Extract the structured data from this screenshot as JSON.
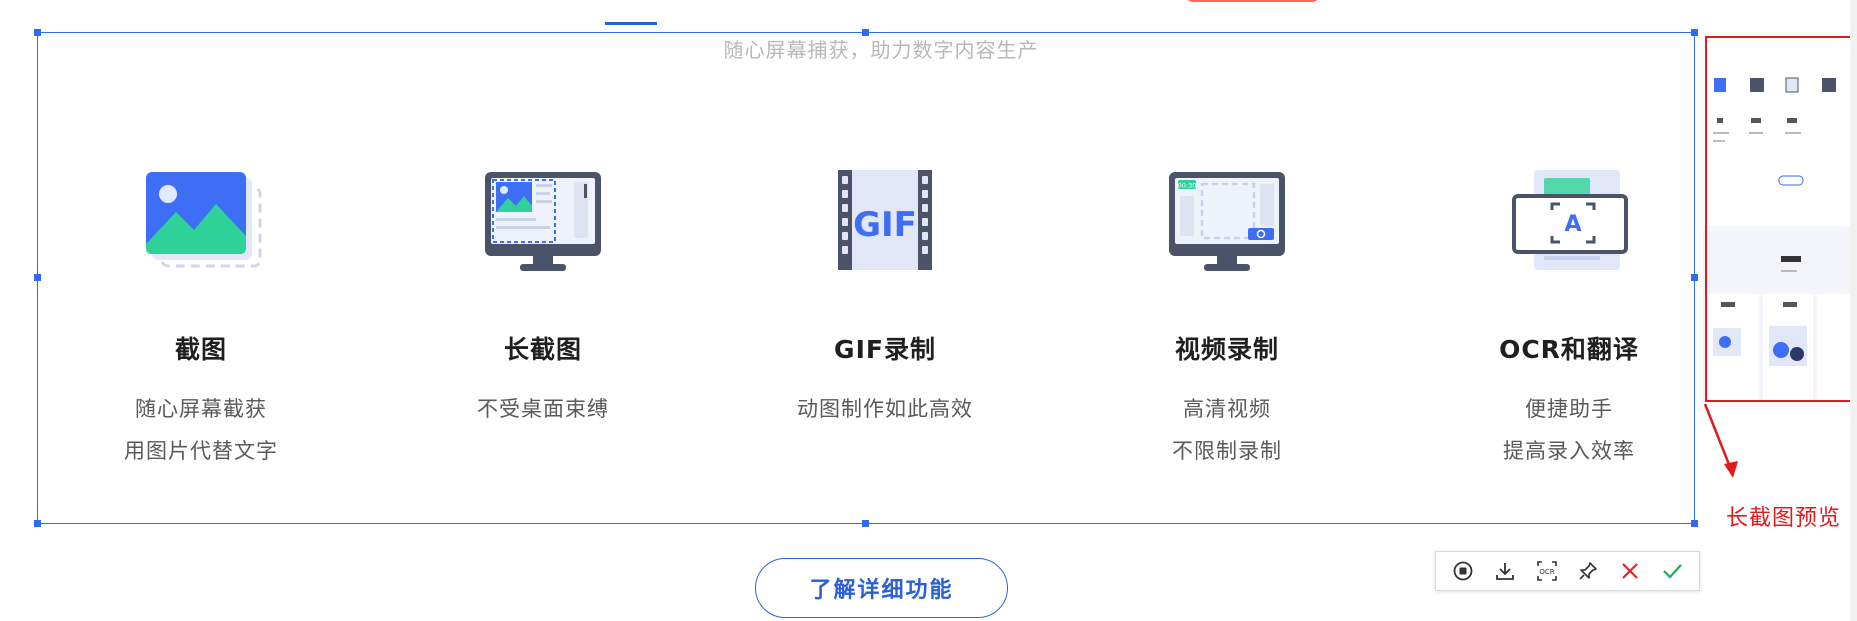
{
  "subtitle": "随心屏幕捕获，助力数字内容生产",
  "features": [
    {
      "title": "截图",
      "desc1": "随心屏幕截获",
      "desc2": "用图片代替文字",
      "icon": "image-icon"
    },
    {
      "title": "长截图",
      "desc1": "不受桌面束缚",
      "desc2": "",
      "icon": "long-screenshot-monitor-icon"
    },
    {
      "title": "GIF录制",
      "desc1": "动图制作如此高效",
      "desc2": "",
      "icon": "gif-film-icon",
      "icon_text": "GIF"
    },
    {
      "title": "视频录制",
      "desc1": "高清视频",
      "desc2": "不限制录制",
      "icon": "video-record-monitor-icon",
      "icon_text": "00:30"
    },
    {
      "title": "OCR和翻译",
      "desc1": "便捷助手",
      "desc2": "提高录入效率",
      "icon": "ocr-icon",
      "icon_text": "A"
    }
  ],
  "detail_button": "了解详细功能",
  "toolbar": {
    "buttons": [
      "record-icon",
      "download-icon",
      "ocr-icon",
      "pin-icon",
      "close-icon",
      "confirm-icon"
    ],
    "ocr_text": "OCR"
  },
  "preview": {
    "label": "长截图预览"
  },
  "colors": {
    "accent": "#2f6cf0",
    "annotation": "#e01b1b",
    "confirm": "#1aab5b",
    "cancel": "#e0252c",
    "icon_blue": "#3d6ef5",
    "icon_green": "#2fd39a"
  }
}
